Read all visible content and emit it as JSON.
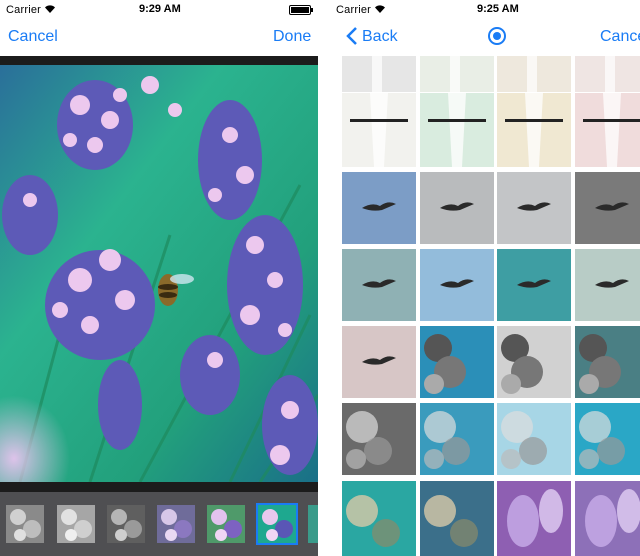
{
  "left_screen": {
    "status": {
      "carrier": "Carrier",
      "time": "9:29 AM"
    },
    "nav": {
      "cancel_label": "Cancel",
      "done_label": "Done"
    },
    "photo": {
      "subject": "lavender-with-bee",
      "palette": [
        "#2bb38f",
        "#5d5ab7",
        "#ecc8ee",
        "#1e7f6b"
      ]
    },
    "filters": [
      {
        "name": "mono-1",
        "tone": "gray"
      },
      {
        "name": "mono-2",
        "tone": "gray-light"
      },
      {
        "name": "mono-3",
        "tone": "gray-dark"
      },
      {
        "name": "color-1",
        "tone": "violet"
      },
      {
        "name": "color-2",
        "tone": "violet-green"
      },
      {
        "name": "color-3",
        "tone": "teal",
        "selected": true
      },
      {
        "name": "color-4",
        "tone": "partial"
      }
    ]
  },
  "right_screen": {
    "status": {
      "carrier": "Carrier",
      "time": "9:25 AM"
    },
    "nav": {
      "back_label": "Back",
      "cancel_label": "Cancel",
      "center_icon": "target-icon"
    },
    "grid_rows": [
      {
        "subject": "faucet-top",
        "tints": [
          "#e6e6e6",
          "#e9eee6",
          "#eee8dd",
          "#efe5e3"
        ]
      },
      {
        "subject": "faucet",
        "tints": [
          "#f2f2ee",
          "#d9ecdf",
          "#f0e8d2",
          "#f0dcdc"
        ]
      },
      {
        "subject": "bird",
        "tints": [
          "#7c9dc6",
          "#b9bbbd",
          "#c3c5c7",
          "#7a7a7a"
        ]
      },
      {
        "subject": "bird",
        "tints": [
          "#8fb1b4",
          "#93bcdb",
          "#3e9ea3",
          "#b8ccc6"
        ]
      },
      {
        "subject": "bird-flowers",
        "tints": [
          "#d7c6c6",
          "#2b8fb8",
          "#d1d1d1",
          "#4a7f84"
        ]
      },
      {
        "subject": "flowers",
        "tints": [
          "#6a6a6a",
          "#3a9bbd",
          "#a7d6e6",
          "#2aa7c6"
        ]
      },
      {
        "subject": "flowers-lavender",
        "tints": [
          "#2aa7a2",
          "#3b6f8a",
          "#8e5fb2",
          "#8d70b8"
        ]
      }
    ]
  }
}
